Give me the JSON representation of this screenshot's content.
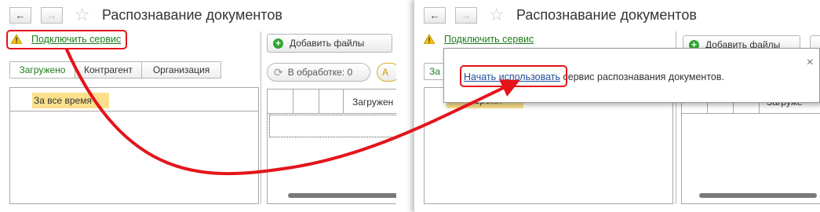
{
  "left": {
    "title": "Распознавание документов",
    "connect_link": "Подключить сервис",
    "add_files_label": "Добавить файлы",
    "processing_label": "В обработке: 0",
    "tabs": [
      {
        "label": "Загружено",
        "active": true
      },
      {
        "label": "Контрагент",
        "active": false
      },
      {
        "label": "Организация",
        "active": false
      }
    ],
    "period_row": "За все время",
    "table_header_loaded": "Загружен"
  },
  "right": {
    "title": "Распознавание документов",
    "connect_link": "Подключить сервис",
    "add_files_label": "Добавить файлы",
    "tab_partial": "За",
    "table_header_partial": "Загруже",
    "period_partial": "время",
    "popup": {
      "link": "Начать использовать",
      "text": " сервис распознавания документов.",
      "close": "×"
    }
  },
  "colors": {
    "annotation_red": "#e4141b",
    "link_green": "#1d7d1d",
    "popup_link_blue": "#1f4e9c",
    "highlight_yellow": "#fbe08c",
    "add_icon_green": "#2fa52f"
  }
}
